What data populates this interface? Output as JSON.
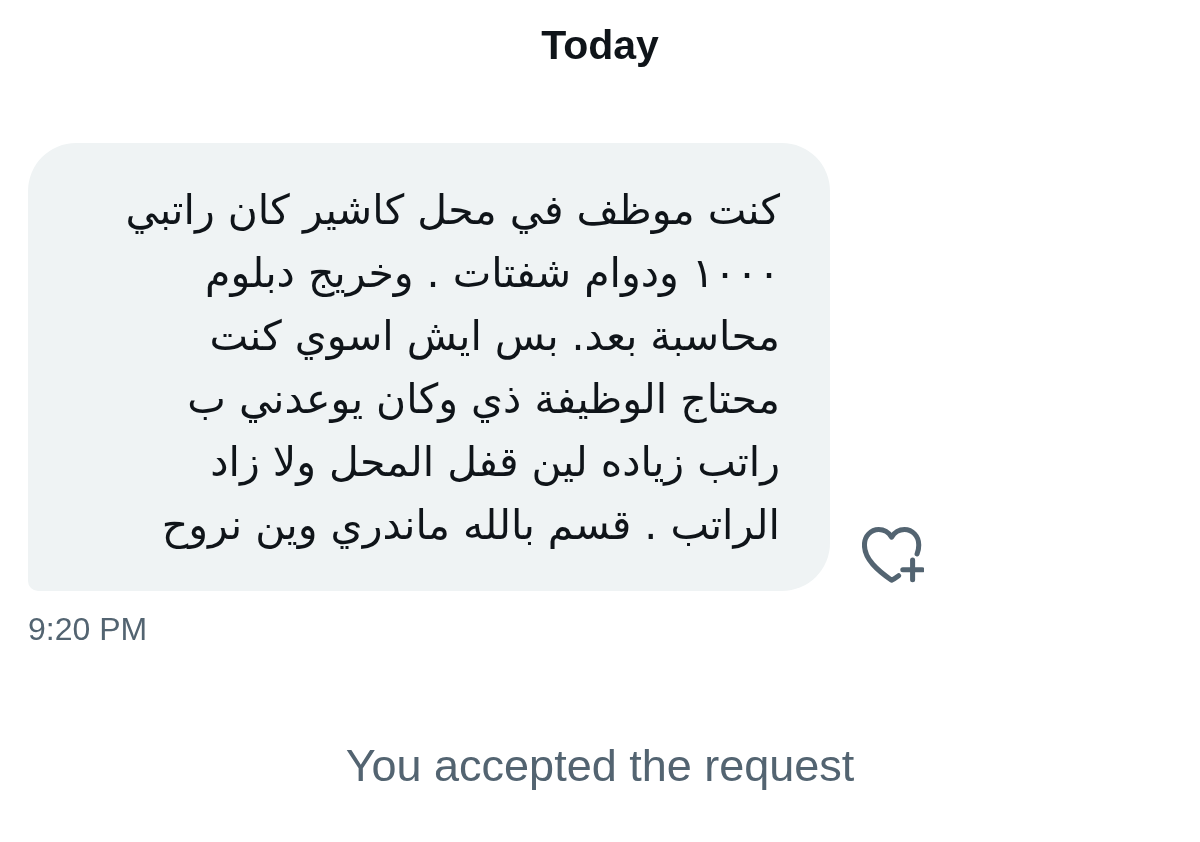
{
  "date_header": "Today",
  "messages": [
    {
      "text": "كنت موظف في محل كاشير كان راتبي\n١٠٠٠ ودوام شفتات . وخريج دبلوم\nمحاسبة بعد. بس ايش اسوي كنت\nمحتاج الوظيفة ذي وكان يوعدني ب\nراتب زياده لين قفل المحل ولا زاد\nالراتب . قسم بالله ماندري وين نروح",
      "time": "9:20 PM"
    }
  ],
  "notice": "You accepted the request"
}
